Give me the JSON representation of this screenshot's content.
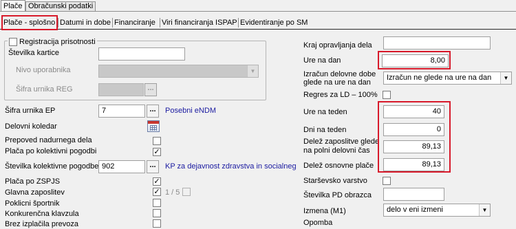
{
  "top_tabs": [
    {
      "label": "Plače"
    },
    {
      "label": "Obračunski podatki"
    }
  ],
  "sub_tabs": [
    {
      "label": "Plače - splošno"
    },
    {
      "label": "Datumi in dobe"
    },
    {
      "label": "Financiranje"
    },
    {
      "label": "Viri financiranja ISPAP"
    },
    {
      "label": "Evidentiranje po SM"
    }
  ],
  "left": {
    "registracija_label": "Registracija prisotnosti",
    "stevilka_kartice_label": "Številka kartice",
    "stevilka_kartice_value": "",
    "nivo_uporabnika_label": "Nivo uporabnika",
    "sifra_urnika_reg_label": "Šifra urnika REG",
    "sifra_urnika_ep_label": "Šifra urnika EP",
    "sifra_urnika_ep_value": "7",
    "sifra_urnika_ep_desc": "Posebni eNDM",
    "delovni_koledar_label": "Delovni koledar",
    "prepoved_label": "Prepoved nadurnega dela",
    "placa_kp_label": "Plača po kolektivni pogodbi",
    "placa_kp_checked": "✓",
    "stevilka_kp_label": "Številka kolektivne pogodbe",
    "stevilka_kp_value": "902",
    "stevilka_kp_desc": "KP za dejavnost zdravstva in socialneg",
    "placa_zspjs_label": "Plača po ZSPJS",
    "placa_zspjs_checked": "✓",
    "glavna_zaposlitev_label": "Glavna zaposlitev",
    "glavna_zaposlitev_checked": "✓",
    "glavna_zaposlitev_ratio": "1 / 5",
    "poklicni_sportnik_label": "Poklicni športnik",
    "konkurencna_label": "Konkurenčna klavzula",
    "brez_prevoza_label": "Brez izplačila prevoza"
  },
  "right": {
    "kraj_label": "Kraj opravljanja dela",
    "kraj_value": "",
    "ure_na_dan_label": "Ure na dan",
    "ure_na_dan_value": "8,00",
    "izracun_label_1": "Izračun delovne dobe",
    "izracun_label_2": "glede na ure na dan",
    "izracun_value": "Izračun ne glede na ure na dan",
    "regres_label": "Regres za LD – 100%",
    "ure_na_teden_label": "Ure na teden",
    "ure_na_teden_value": "40",
    "dni_na_teden_label": "Dni na teden",
    "dni_na_teden_value": "0",
    "delez_zaposlitve_label_1": "Delež zaposlitve glede",
    "delez_zaposlitve_label_2": "na polni delovni čas",
    "delez_zaposlitve_value": "89,13",
    "delez_osnovne_label": "Delež osnovne plače",
    "delez_osnovne_value": "89,13",
    "starsevsko_label": "Starševsko varstvo",
    "stevilka_pd_label": "Številka PD obrazca",
    "stevilka_pd_value": "",
    "izmena_label": "Izmena (M1)",
    "izmena_value": "delo v eni izmeni",
    "opomba_label": "Opomba"
  },
  "ui": {
    "dots": "...",
    "check_mark": "✓",
    "down_arrow": "▼"
  },
  "colors": {
    "highlight": "#d8192a",
    "link_blue": "#1a1aa0"
  }
}
